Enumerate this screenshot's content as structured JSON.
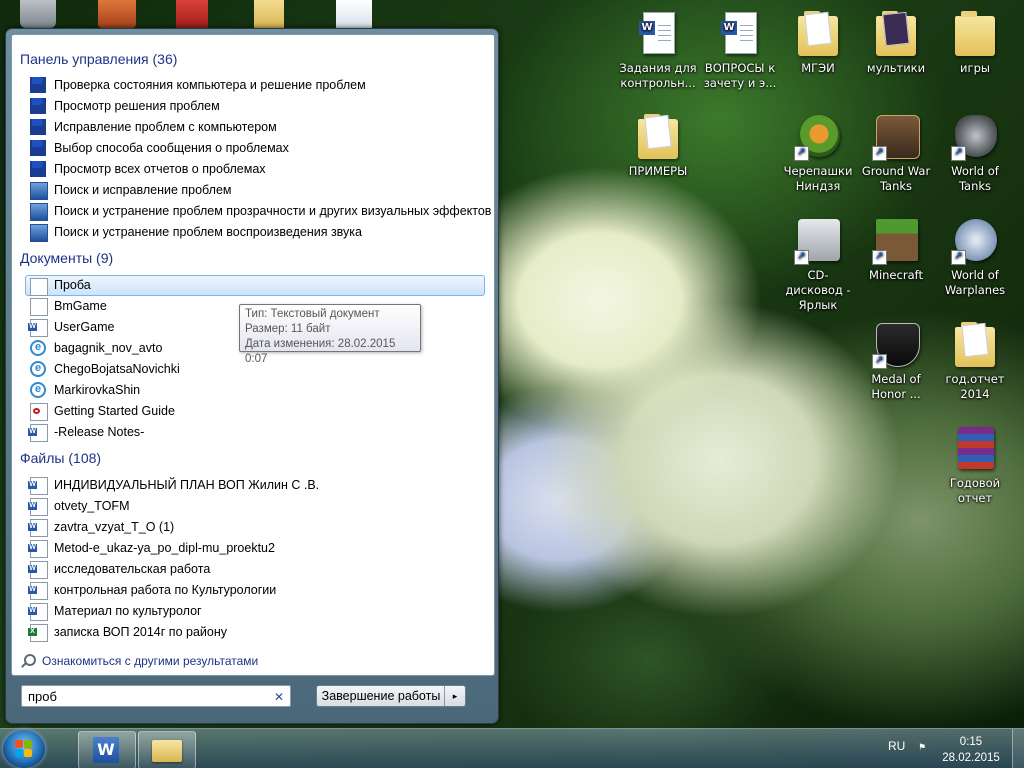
{
  "search_results": {
    "groups": [
      {
        "title": "Панель управления (36)",
        "items": [
          {
            "label": "Проверка состояния компьютера и решение проблем",
            "icon": "flag-icon"
          },
          {
            "label": "Просмотр решения проблем",
            "icon": "flag-icon"
          },
          {
            "label": "Исправление проблем с компьютером",
            "icon": "flag-icon"
          },
          {
            "label": "Выбор способа сообщения о проблемах",
            "icon": "flag-icon"
          },
          {
            "label": "Просмотр всех отчетов о проблемах",
            "icon": "flag-icon"
          },
          {
            "label": "Поиск и исправление проблем",
            "icon": "troubleshoot-icon"
          },
          {
            "label": "Поиск и устранение проблем прозрачности и других визуальных эффектов",
            "icon": "troubleshoot-icon"
          },
          {
            "label": "Поиск и устранение проблем воспроизведения звука",
            "icon": "troubleshoot-icon"
          }
        ]
      },
      {
        "title": "Документы (9)",
        "items": [
          {
            "label": "Проба",
            "icon": "text-document-icon",
            "selected": true
          },
          {
            "label": "BmGame",
            "icon": "generic-file-icon"
          },
          {
            "label": "UserGame",
            "icon": "word-document-icon"
          },
          {
            "label": "bagagnik_nov_avto",
            "icon": "ie-icon"
          },
          {
            "label": "ChegoBojatsaNovichki",
            "icon": "ie-icon"
          },
          {
            "label": "MarkirovkaShin",
            "icon": "ie-icon"
          },
          {
            "label": "Getting Started Guide",
            "icon": "pdf-icon"
          },
          {
            "label": "-Release Notes-",
            "icon": "word-document-icon"
          }
        ]
      },
      {
        "title": "Файлы (108)",
        "items": [
          {
            "label": "ИНДИВИДУАЛЬНЫЙ ПЛАН ВОП Жилин С .В.",
            "icon": "word-document-icon"
          },
          {
            "label": "otvety_TOFM",
            "icon": "word-document-icon"
          },
          {
            "label": "zavtra_vzyat_T_O (1)",
            "icon": "word-document-icon"
          },
          {
            "label": "Metod-e_ukaz-ya_po_dipl-mu_proektu2",
            "icon": "word-document-icon"
          },
          {
            "label": "исследовательская работа",
            "icon": "word-document-icon"
          },
          {
            "label": "контрольная работа по Культурологии",
            "icon": "word-document-icon"
          },
          {
            "label": "Материал по культуролог",
            "icon": "word-document-icon"
          },
          {
            "label": "записка ВОП 2014г по району",
            "icon": "excel-document-icon"
          }
        ]
      }
    ],
    "more_results": "Ознакомиться с другими результатами"
  },
  "tooltip": {
    "type_line": "Тип: Текстовый документ",
    "size_line": "Размер: 11 байт",
    "modified_line": "Дата изменения: 28.02.2015 0:07"
  },
  "search_box": {
    "value": "проб",
    "clear_icon": "clear-icon"
  },
  "shutdown": {
    "label": "Завершение работы",
    "arrow": "▸"
  },
  "desktop_icons": [
    {
      "label": "Задания для контрольн...",
      "icon": "word-document-icon"
    },
    {
      "label": "ВОПРОСЫ к зачету и э...",
      "icon": "word-document-icon"
    },
    {
      "label": "МГЭИ",
      "icon": "folder-icon"
    },
    {
      "label": "мультики",
      "icon": "folder-icon"
    },
    {
      "label": "игры",
      "icon": "folder-icon"
    },
    {
      "label": "ПРИМЕРЫ",
      "icon": "folder-icon"
    },
    {
      "label": "Черепашки Ниндзя",
      "icon": "turtle-game-icon"
    },
    {
      "label": "Ground War Tanks",
      "icon": "ground-war-tanks-icon"
    },
    {
      "label": "World of Tanks",
      "icon": "world-of-tanks-icon"
    },
    {
      "label": "CD-дисковод - Ярлык",
      "icon": "dvd-drive-icon"
    },
    {
      "label": "Minecraft",
      "icon": "minecraft-icon"
    },
    {
      "label": "World of Warplanes",
      "icon": "world-of-warplanes-icon"
    },
    {
      "label": "Medal of Honor ...",
      "icon": "medal-of-honor-icon"
    },
    {
      "label": "год.отчет 2014",
      "icon": "folder-icon"
    },
    {
      "label": "Годовой отчет",
      "icon": "winrar-archive-icon"
    }
  ],
  "taskbar": {
    "pinned": [
      {
        "name": "word-taskbar-button",
        "icon": "word-icon",
        "letter": "W"
      },
      {
        "name": "explorer-taskbar-button",
        "icon": "folder-icon"
      }
    ],
    "language": "RU",
    "time": "0:15",
    "date": "28.02.2015"
  },
  "colors": {
    "group_header": "#1e3287",
    "selection": "#cde3fb",
    "taskbar": "#2d4b5f"
  }
}
